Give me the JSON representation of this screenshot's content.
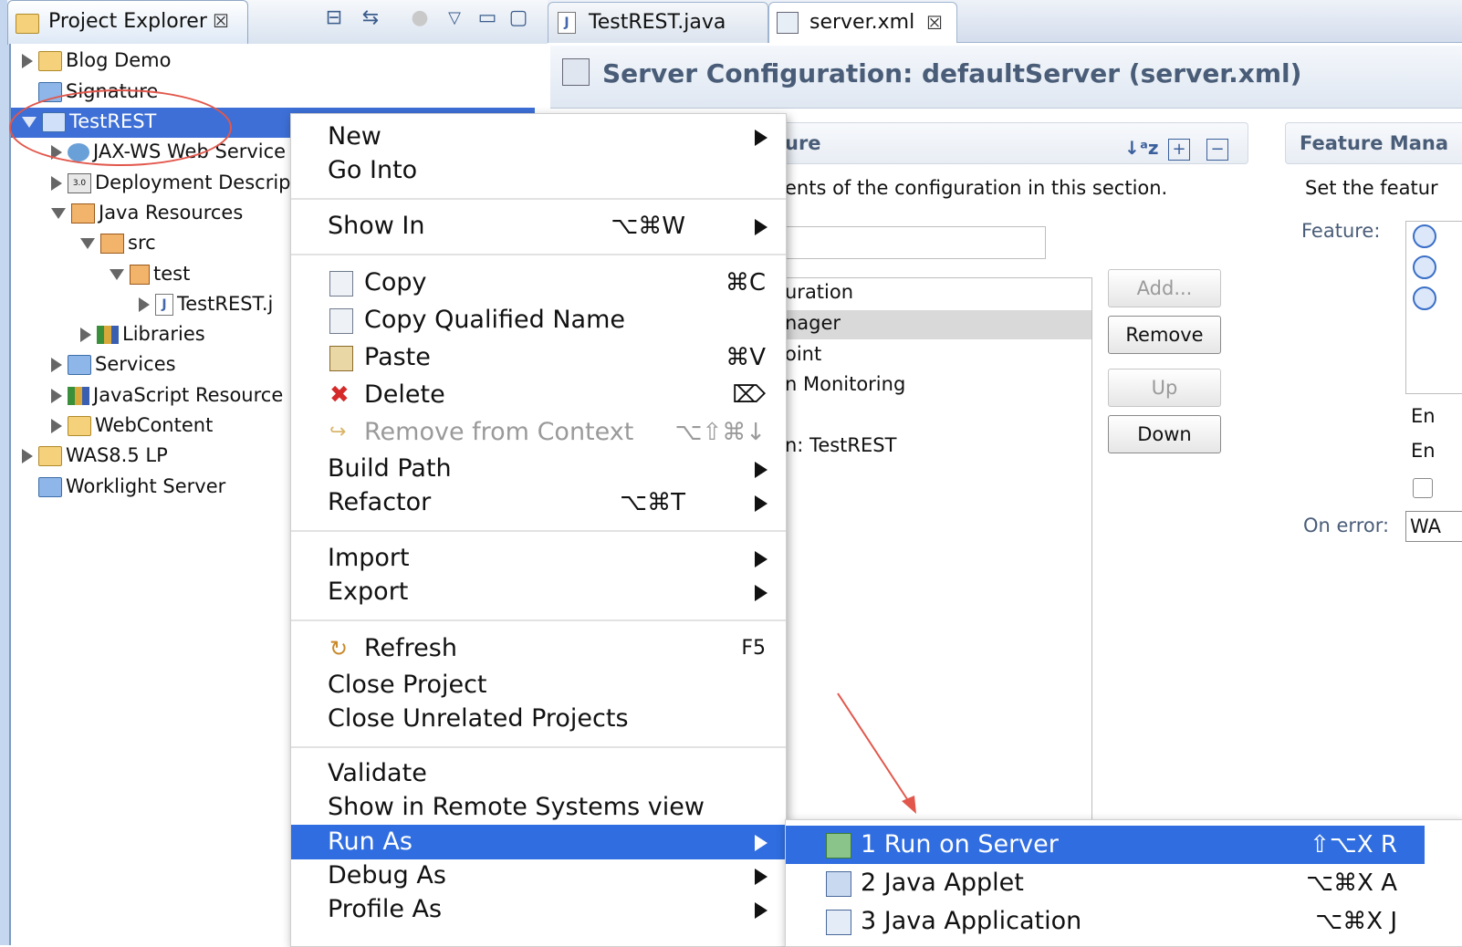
{
  "explorer": {
    "tab_title": "Project Explorer",
    "tree": [
      {
        "label": "Blog Demo"
      },
      {
        "label": "Signature"
      },
      {
        "label": "TestREST"
      },
      {
        "label": "JAX-WS Web Service"
      },
      {
        "label": "Deployment Descrip"
      },
      {
        "label": "Java Resources"
      },
      {
        "label": "src"
      },
      {
        "label": "test"
      },
      {
        "label": "TestREST.j"
      },
      {
        "label": "Libraries"
      },
      {
        "label": "Services"
      },
      {
        "label": "JavaScript Resource"
      },
      {
        "label": "WebContent"
      },
      {
        "label": "WAS8.5 LP"
      },
      {
        "label": "Worklight Server"
      }
    ],
    "selected_item": "TestREST"
  },
  "editor": {
    "tabs": [
      {
        "label": "TestREST.java"
      },
      {
        "label": "server.xml"
      }
    ],
    "active_tab": "server.xml",
    "title": "Server Configuration: defaultServer (server.xml)",
    "config_section": {
      "title_fragment": "ure",
      "description_fragment": "ents of the configuration in this section.",
      "tree_fragments": [
        "uration",
        "nager",
        "oint",
        "n Monitoring",
        "n: TestREST"
      ],
      "buttons": {
        "add": "Add...",
        "remove": "Remove",
        "up": "Up",
        "down": "Down"
      }
    },
    "feature_section": {
      "title": "Feature Mana",
      "description": "Set the featur",
      "feature_label": "Feature:",
      "en1": "En",
      "en2": "En",
      "on_error_label": "On error:",
      "on_error_value": "WA"
    }
  },
  "context_menu": {
    "items": [
      {
        "label": "New",
        "shortcut": "",
        "submenu": true
      },
      {
        "label": "Go Into",
        "shortcut": "",
        "submenu": false
      },
      {
        "label": "Show In",
        "shortcut": "⌥⌘W",
        "submenu": true
      },
      {
        "label": "Copy",
        "shortcut": "⌘C",
        "icon": "copy-icon"
      },
      {
        "label": "Copy Qualified Name",
        "shortcut": "",
        "icon": "copy-qualified-icon"
      },
      {
        "label": "Paste",
        "shortcut": "⌘V",
        "icon": "paste-icon"
      },
      {
        "label": "Delete",
        "shortcut": "⌦",
        "icon": "delete-icon"
      },
      {
        "label": "Remove from Context",
        "shortcut": "⌥⇧⌘↓",
        "icon": "remove-context-icon",
        "disabled": true
      },
      {
        "label": "Build Path",
        "shortcut": "",
        "submenu": true
      },
      {
        "label": "Refactor",
        "shortcut": "⌥⌘T",
        "submenu": true
      },
      {
        "label": "Import",
        "shortcut": "",
        "submenu": true
      },
      {
        "label": "Export",
        "shortcut": "",
        "submenu": true
      },
      {
        "label": "Refresh",
        "shortcut": "F5",
        "icon": "refresh-icon"
      },
      {
        "label": "Close Project",
        "shortcut": ""
      },
      {
        "label": "Close Unrelated Projects",
        "shortcut": ""
      },
      {
        "label": "Validate",
        "shortcut": ""
      },
      {
        "label": "Show in Remote Systems view",
        "shortcut": ""
      },
      {
        "label": "Run As",
        "shortcut": "",
        "submenu": true,
        "highlighted": true
      },
      {
        "label": "Debug As",
        "shortcut": "",
        "submenu": true
      },
      {
        "label": "Profile As",
        "shortcut": "",
        "submenu": true
      }
    ]
  },
  "run_as_submenu": {
    "items": [
      {
        "label": "1 Run on Server",
        "shortcut": "⇧⌥X R",
        "icon": "run-on-server-icon",
        "highlighted": true
      },
      {
        "label": "2 Java Applet",
        "shortcut": "⌥⌘X A",
        "icon": "java-applet-icon"
      },
      {
        "label": "3 Java Application",
        "shortcut": "⌥⌘X J",
        "icon": "java-application-icon"
      }
    ]
  },
  "colors": {
    "selection": "#3d6fd6",
    "menu_highlight": "#2f6de0",
    "annotation_red": "#e2574c"
  }
}
